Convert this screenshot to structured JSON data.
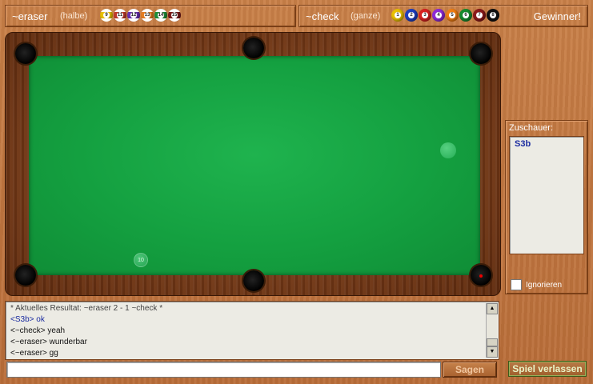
{
  "players": [
    {
      "name": "~eraser",
      "group": "(halbe)",
      "balls": [
        {
          "number": "9",
          "color": "#e8c000"
        },
        {
          "number": "11",
          "color": "#c0392b"
        },
        {
          "number": "12",
          "color": "#6a2fb0"
        },
        {
          "number": "13",
          "color": "#e67e22"
        },
        {
          "number": "14",
          "color": "#1e8f3a"
        },
        {
          "number": "15",
          "color": "#7a1a1a"
        }
      ]
    },
    {
      "name": "~check",
      "group": "(ganze)",
      "balls": [
        {
          "number": "1",
          "color": "#e8c000"
        },
        {
          "number": "2",
          "color": "#1f3fbf"
        },
        {
          "number": "3",
          "color": "#d62020"
        },
        {
          "number": "4",
          "color": "#8e2bd6"
        },
        {
          "number": "5",
          "color": "#f07d12"
        },
        {
          "number": "6",
          "color": "#178a2e"
        },
        {
          "number": "7",
          "color": "#8a1a1a"
        },
        {
          "number": "8",
          "color": "#111111"
        }
      ]
    }
  ],
  "winner_label": "Gewinner!",
  "table": {
    "felt_color": "#14a040",
    "rail_color": "#7a3a16",
    "ball_10_label": "10"
  },
  "spectators": {
    "title": "Zuschauer:",
    "names": [
      "S3b"
    ],
    "ignore_label": "Ignorieren"
  },
  "chat": {
    "lines": [
      {
        "text": "* Aktuelles Resultat: ~eraser 2 - 1 ~check *",
        "style": "sys"
      },
      {
        "text": "<S3b> ok",
        "style": "blue"
      },
      {
        "text": "<~check> yeah",
        "style": "normal"
      },
      {
        "text": "<~eraser> wunderbar",
        "style": "normal"
      },
      {
        "text": "<~eraser> gg",
        "style": "normal"
      }
    ],
    "input_value": "",
    "send_label": "Sagen",
    "scroll_up": "▲",
    "scroll_down": "▼"
  },
  "leave_label": "Spiel verlassen"
}
